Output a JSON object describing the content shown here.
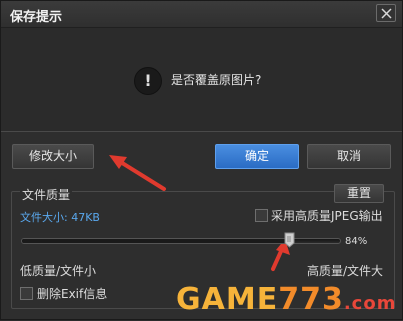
{
  "dialog": {
    "title": "保存提示",
    "close_glyph": "✕",
    "icon": "exclamation-icon",
    "message": "是否覆盖原图片?",
    "warning_glyph": "!"
  },
  "buttons": {
    "resize": "修改大小",
    "confirm": "确定",
    "cancel": "取消",
    "reset": "重置"
  },
  "quality": {
    "group_title": "文件质量",
    "file_size": "文件大小: 47KB",
    "high_quality_jpeg_label": "采用高质量JPEG输出",
    "high_quality_jpeg_checked": false,
    "slider_percent": 84,
    "slider_label": "84%",
    "low_label": "低质量/文件小",
    "high_label": "高质量/文件大",
    "remove_exif_label": "删除Exif信息",
    "remove_exif_checked": false
  },
  "colors": {
    "primary": "#2a6cc4",
    "background": "#2e2e2e",
    "arrow": "#e03a2e"
  },
  "watermark": {
    "part1": "GAME",
    "part2": "773",
    "part3": ".com"
  }
}
